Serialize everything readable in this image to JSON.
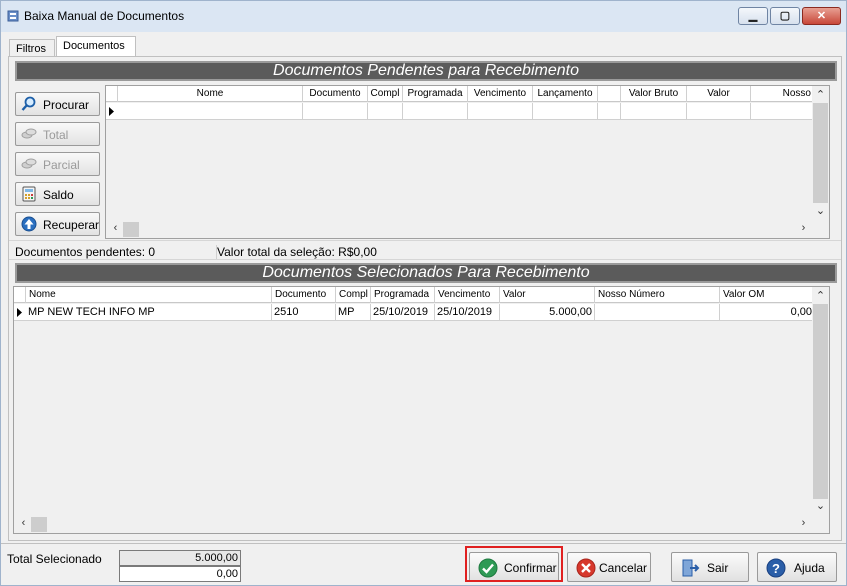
{
  "window": {
    "title": "Baixa Manual de Documentos"
  },
  "tabs": [
    {
      "label": "Filtros"
    },
    {
      "label": "Documentos"
    }
  ],
  "pendentes": {
    "header": "Documentos Pendentes para Recebimento",
    "columns": [
      "Nome",
      "Documento",
      "Compl",
      "Programada",
      "Vencimento",
      "Lançamento",
      "",
      "Valor Bruto",
      "Valor",
      "Nosso"
    ],
    "status_count": "Documentos pendentes: 0",
    "status_total": "Valor total da seleção: R$0,00"
  },
  "side_buttons": [
    {
      "label": "Procurar",
      "icon": "search-icon",
      "enabled": true
    },
    {
      "label": "Total",
      "icon": "money-icon",
      "enabled": false
    },
    {
      "label": "Parcial",
      "icon": "money-icon",
      "enabled": false
    },
    {
      "label": "Saldo",
      "icon": "calculator-icon",
      "enabled": true
    },
    {
      "label": "Recuperar",
      "icon": "up-arrow-icon",
      "enabled": true
    }
  ],
  "selecionados": {
    "header": "Documentos Selecionados Para Recebimento",
    "columns": [
      "Nome",
      "Documento",
      "Compl",
      "Programada",
      "Vencimento",
      "Valor",
      "Nosso Número",
      "Valor OM"
    ],
    "rows": [
      {
        "nome": "MP NEW TECH INFO MP",
        "documento": "2510",
        "compl": "MP",
        "programada": "25/10/2019",
        "vencimento": "25/10/2019",
        "valor": "5.000,00",
        "nosso": "",
        "valor_om": "0,00"
      }
    ]
  },
  "footer": {
    "total_label": "Total Selecionado",
    "total_value": "5.000,00",
    "total_value2": "0,00",
    "buttons": [
      {
        "label": "Confirmar",
        "icon": "check-icon"
      },
      {
        "label": "Cancelar",
        "icon": "cancel-icon"
      },
      {
        "label": "Sair",
        "icon": "exit-icon"
      },
      {
        "label": "Ajuda",
        "icon": "help-icon"
      }
    ]
  },
  "colors": {
    "confirm": "#2e9a55",
    "cancel": "#d7382c",
    "help": "#2a5ea8",
    "focus": "#e02020"
  }
}
